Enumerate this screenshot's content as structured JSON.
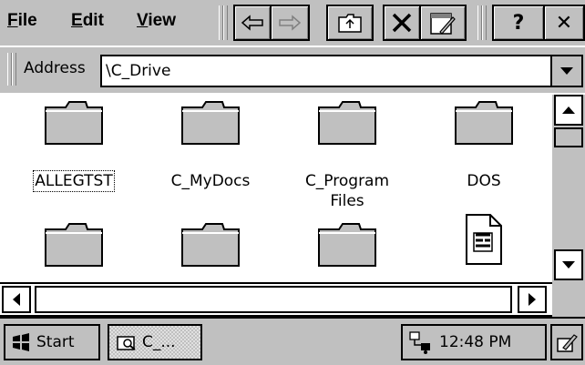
{
  "menu": {
    "file": {
      "accel": "F",
      "rest": "ile"
    },
    "edit": {
      "accel": "E",
      "rest": "dit"
    },
    "view": {
      "accel": "V",
      "rest": "iew"
    }
  },
  "toolbar": {
    "buttons": [
      "back-icon",
      "forward-icon",
      "up-folder-icon",
      "delete-icon",
      "properties-icon",
      "help-icon",
      "close-icon"
    ],
    "help_label": "?",
    "close_label": "✕"
  },
  "address": {
    "label": "Address",
    "value": "\\C_Drive"
  },
  "files": [
    {
      "name": "ALLEGTST",
      "type": "folder",
      "selected": true
    },
    {
      "name": "C_MyDocs",
      "type": "folder"
    },
    {
      "name": "C_Program Files",
      "type": "folder"
    },
    {
      "name": "DOS",
      "type": "folder"
    },
    {
      "name": "",
      "type": "folder"
    },
    {
      "name": "",
      "type": "folder"
    },
    {
      "name": "",
      "type": "folder"
    },
    {
      "name": "",
      "type": "document"
    }
  ],
  "taskbar": {
    "start_label": "Start",
    "task_label": "C_...",
    "clock": "12:48 PM"
  },
  "colors": {
    "chrome": "#c0c0c0",
    "folder_fill": "#c0c0c0",
    "window": "#ffffff"
  }
}
